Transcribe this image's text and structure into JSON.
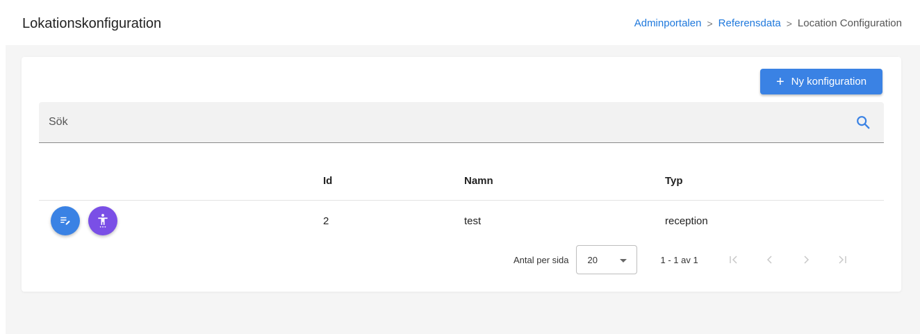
{
  "header": {
    "title": "Lokationskonfiguration",
    "breadcrumb": {
      "items": [
        "Adminportalen",
        "Referensdata"
      ],
      "current": "Location Configuration",
      "separator": ">"
    }
  },
  "toolbar": {
    "new_button_label": "Ny konfiguration",
    "new_button_icon": "plus-icon"
  },
  "search": {
    "placeholder": "Sök",
    "value": "",
    "icon": "search-icon"
  },
  "table": {
    "columns": [
      "",
      "Id",
      "Namn",
      "Typ"
    ],
    "rows": [
      {
        "id": "2",
        "name": "test",
        "type": "reception",
        "actions": [
          "edit-icon",
          "accessibility-icon"
        ]
      }
    ]
  },
  "pagination": {
    "per_page_label": "Antal per sida",
    "per_page_value": "20",
    "range_label": "1 - 1 av 1",
    "nav_icons": [
      "first-page-icon",
      "previous-page-icon",
      "next-page-icon",
      "last-page-icon"
    ]
  },
  "colors": {
    "primary": "#3a82e4",
    "accent_purple": "#7a4fe6",
    "link": "#1e78dc",
    "background": "#f5f5f5"
  }
}
